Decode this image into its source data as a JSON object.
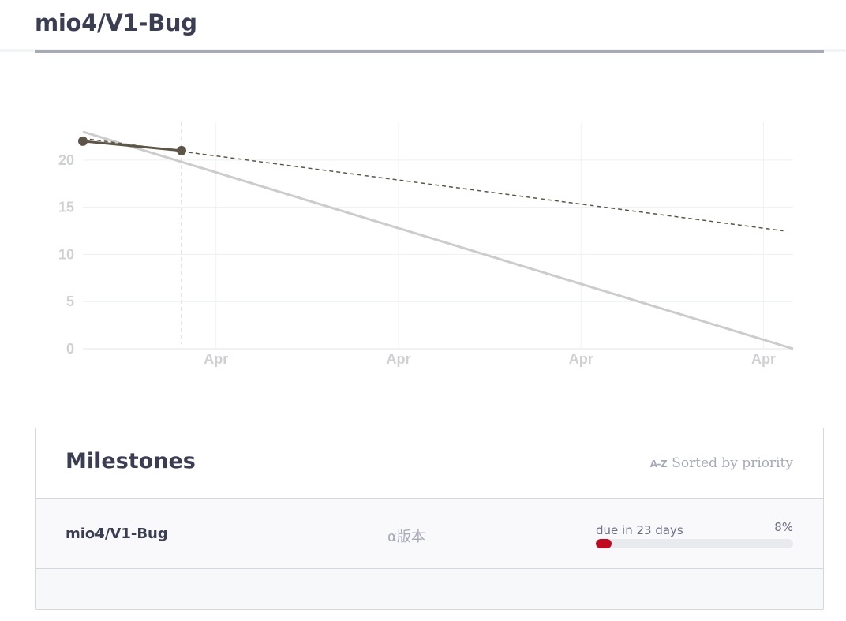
{
  "header": {
    "title": "mio4/V1-Bug"
  },
  "chart_data": {
    "type": "line",
    "y_ticks": [
      "0",
      "5",
      "10",
      "15",
      "20"
    ],
    "x_ticks": [
      "Apr",
      "Apr",
      "Apr",
      "Apr"
    ],
    "ylim": [
      0,
      24
    ],
    "grid": true,
    "series": [
      {
        "style": "ideal",
        "color": "#cccccc",
        "x": [
          0,
          7.2
        ],
        "y": [
          23,
          0
        ]
      },
      {
        "style": "actual",
        "color": "#5e5549",
        "x": [
          0,
          1
        ],
        "y": [
          22,
          21
        ]
      },
      {
        "style": "projection",
        "color": "#5e5549",
        "x": [
          0,
          7.1
        ],
        "y": [
          22.3,
          12.5
        ]
      }
    ],
    "marker": {
      "x": 1
    }
  },
  "milestones": {
    "title": "Milestones",
    "sort_icon": "A-Z",
    "sort_label": "Sorted by priority",
    "rows": [
      {
        "name": "mio4/V1-Bug",
        "version": "α版本",
        "due": "due in 23 days",
        "percent_label": "8%",
        "progress": 0.08,
        "progress_color": "#c1091f"
      }
    ]
  }
}
